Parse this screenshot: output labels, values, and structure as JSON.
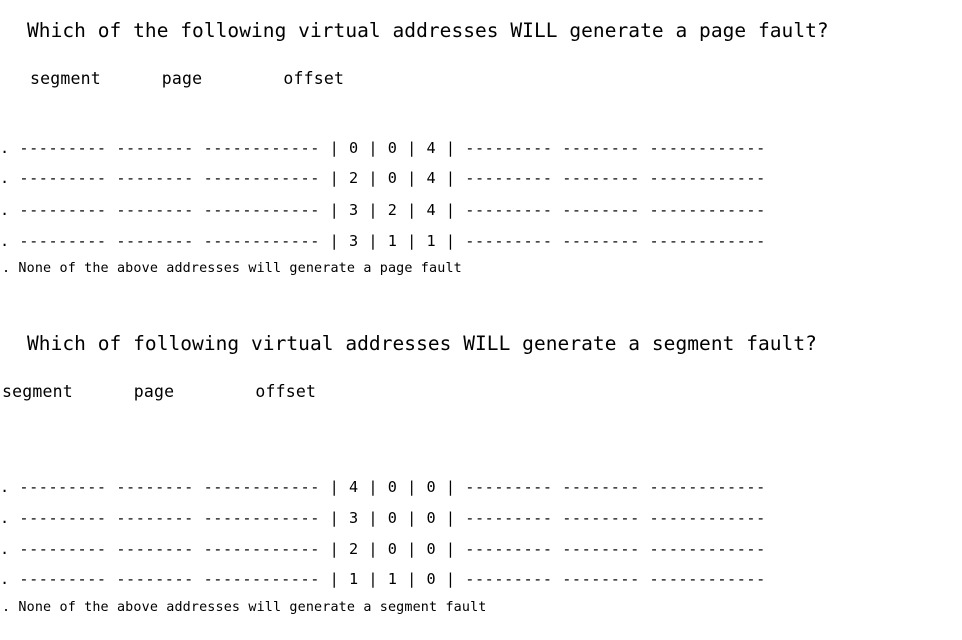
{
  "document": {
    "title": "Virtual address page fault / segment fault multiple choice questions",
    "background_color": "#ffffff",
    "text_color": "#000000"
  },
  "sections": [
    {
      "id": "page-fault",
      "question": "Which of the following virtual addresses WILL generate a page fault?",
      "legend": "segment      page        offset",
      "table": {
        "columns": [
          "segment",
          "page",
          "offset"
        ],
        "rows": [
          {
            "bullet": ".",
            "left_rule": "--------- -------- ------------",
            "cells": [
              "0",
              "0",
              "4"
            ],
            "right_rule": "--------- -------- ------------"
          },
          {
            "bullet": ".",
            "left_rule": "--------- -------- ------------",
            "cells": [
              "2",
              "0",
              "4"
            ],
            "right_rule": "--------- -------- ------------"
          },
          {
            "bullet": ".",
            "left_rule": "--------- -------- ------------",
            "cells": [
              "3",
              "2",
              "4"
            ],
            "right_rule": "--------- -------- ------------"
          },
          {
            "bullet": ".",
            "left_rule": "--------- -------- ------------",
            "cells": [
              "3",
              "1",
              "1"
            ],
            "right_rule": "--------- -------- ------------"
          }
        ]
      },
      "none_option": ". None of the above addresses will generate a page fault"
    },
    {
      "id": "segment-fault",
      "question": "Which of following virtual addresses WILL generate a segment fault?",
      "legend": "segment      page        offset",
      "table": {
        "columns": [
          "segment",
          "page",
          "offset"
        ],
        "rows": [
          {
            "bullet": ".",
            "left_rule": "--------- -------- ------------",
            "cells": [
              "4",
              "0",
              "0"
            ],
            "right_rule": "--------- -------- ------------"
          },
          {
            "bullet": ".",
            "left_rule": "--------- -------- ------------",
            "cells": [
              "3",
              "0",
              "0"
            ],
            "right_rule": "--------- -------- ------------"
          },
          {
            "bullet": ".",
            "left_rule": "--------- -------- ------------",
            "cells": [
              "2",
              "0",
              "0"
            ],
            "right_rule": "--------- -------- ------------"
          },
          {
            "bullet": ".",
            "left_rule": "--------- -------- ------------",
            "cells": [
              "1",
              "1",
              "0"
            ],
            "right_rule": "--------- -------- ------------"
          }
        ]
      },
      "none_option": ". None of the above addresses will generate a segment fault"
    }
  ],
  "rendered_lines": {
    "s1_row1": ". --------- -------- ------------ | 0 | 0 | 4 | --------- -------- ------------",
    "s1_row2": ". --------- -------- ------------ | 2 | 0 | 4 | --------- -------- ------------",
    "s1_row3": ". --------- -------- ------------ | 3 | 2 | 4 | --------- -------- ------------",
    "s1_row4": ". --------- -------- ------------ | 3 | 1 | 1 | --------- -------- ------------",
    "s2_row1": ". --------- -------- ------------ | 4 | 0 | 0 | --------- -------- ------------",
    "s2_row2": ". --------- -------- ------------ | 3 | 0 | 0 | --------- -------- ------------",
    "s2_row3": ". --------- -------- ------------ | 2 | 0 | 0 | --------- -------- ------------",
    "s2_row4": ". --------- -------- ------------ | 1 | 1 | 0 | --------- -------- ------------"
  }
}
